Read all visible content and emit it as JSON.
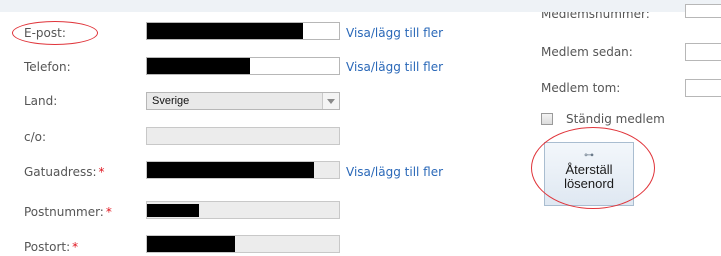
{
  "form": {
    "email": {
      "label": "E-post:",
      "link": "Visa/lägg till fler"
    },
    "phone": {
      "label": "Telefon:",
      "link": "Visa/lägg till fler"
    },
    "country": {
      "label": "Land:",
      "value": "Sverige"
    },
    "co": {
      "label": "c/o:"
    },
    "street": {
      "label": "Gatuadress:",
      "required_mark": "*",
      "link": "Visa/lägg till fler"
    },
    "postal_code": {
      "label": "Postnummer:",
      "required_mark": "*"
    },
    "city": {
      "label": "Postort:",
      "required_mark": "*"
    }
  },
  "membership": {
    "member_number_label": "Medlemsnummer:",
    "member_since_label": "Medlem sedan:",
    "member_until_label": "Medlem tom:",
    "permanent_label": "Ständig medlem",
    "permanent_checked": false
  },
  "reset_button": {
    "line1": "Återställ",
    "line2": "lösenord",
    "icon": "key-icon"
  },
  "colors": {
    "link": "#2a68b8",
    "required": "#e0141e",
    "annotation": "#e0343a"
  }
}
